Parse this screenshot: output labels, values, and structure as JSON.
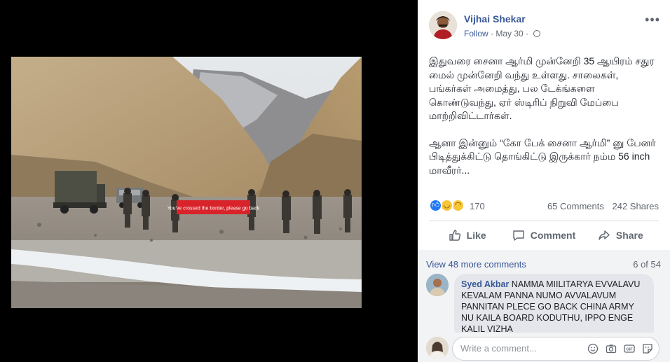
{
  "post": {
    "author": "Vijhai Shekar",
    "follow": "Follow",
    "separator": "·",
    "date": "May 30",
    "text_p1": "இதுவரை சைனா ஆர்மி முன்னேறி 35 ஆயிரம் சதுர மைல் முன்னேறி வந்து உள்ளது. சாலைகள், பங்கர்கள் அமைத்து, பல டேக்ங்களை கொண்டுவந்து, ஏர் ஸ்டிரிப் நிறுவி மேப்பை மாற்றிவிட்டார்கள்.",
    "text_p2": "ஆனா இன்னும் “கோ பேக் சைனா ஆர்மி” னு பேனர் பிடித்துக்கிட்டு தொங்கிட்டு இருக்கார் நம்ம 56 inch மாவீரர்...",
    "banner_text": "You've crossed the border, please go back"
  },
  "stats": {
    "reaction_count": "170",
    "comments": "65 Comments",
    "shares": "242 Shares",
    "reaction_icons": [
      "like-icon",
      "haha-icon",
      "sad-icon"
    ]
  },
  "actions": {
    "like": "Like",
    "comment": "Comment",
    "share": "Share"
  },
  "comments": {
    "view_more": "View 48 more comments",
    "page_count": "6 of 54",
    "items": [
      {
        "author": "Syed Akbar",
        "text": " NAMMA MIILITARYA EVVALAVU KEVALAM PANNA NUMO AVVALAVUM PANNITAN PLECE GO BACK CHINA ARMY NU KAILA BOARD KODUTHU, IPPO ENGE KALIL VIZHA"
      }
    ],
    "composer_placeholder": "Write a comment..."
  },
  "colors": {
    "link": "#385898",
    "accent_blue": "#2078f4",
    "banner_red": "#d8232a"
  }
}
